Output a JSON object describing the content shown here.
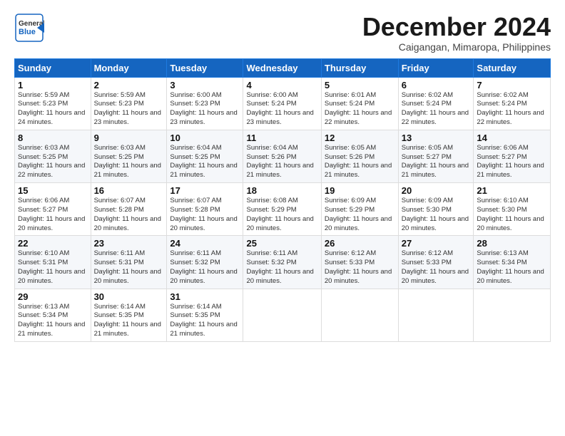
{
  "header": {
    "logo_general": "General",
    "logo_blue": "Blue",
    "month_title": "December 2024",
    "location": "Caigangan, Mimaropa, Philippines"
  },
  "days_of_week": [
    "Sunday",
    "Monday",
    "Tuesday",
    "Wednesday",
    "Thursday",
    "Friday",
    "Saturday"
  ],
  "weeks": [
    [
      {
        "day": "1",
        "sunrise": "Sunrise: 5:59 AM",
        "sunset": "Sunset: 5:23 PM",
        "daylight": "Daylight: 11 hours and 24 minutes."
      },
      {
        "day": "2",
        "sunrise": "Sunrise: 5:59 AM",
        "sunset": "Sunset: 5:23 PM",
        "daylight": "Daylight: 11 hours and 23 minutes."
      },
      {
        "day": "3",
        "sunrise": "Sunrise: 6:00 AM",
        "sunset": "Sunset: 5:23 PM",
        "daylight": "Daylight: 11 hours and 23 minutes."
      },
      {
        "day": "4",
        "sunrise": "Sunrise: 6:00 AM",
        "sunset": "Sunset: 5:24 PM",
        "daylight": "Daylight: 11 hours and 23 minutes."
      },
      {
        "day": "5",
        "sunrise": "Sunrise: 6:01 AM",
        "sunset": "Sunset: 5:24 PM",
        "daylight": "Daylight: 11 hours and 22 minutes."
      },
      {
        "day": "6",
        "sunrise": "Sunrise: 6:02 AM",
        "sunset": "Sunset: 5:24 PM",
        "daylight": "Daylight: 11 hours and 22 minutes."
      },
      {
        "day": "7",
        "sunrise": "Sunrise: 6:02 AM",
        "sunset": "Sunset: 5:24 PM",
        "daylight": "Daylight: 11 hours and 22 minutes."
      }
    ],
    [
      {
        "day": "8",
        "sunrise": "Sunrise: 6:03 AM",
        "sunset": "Sunset: 5:25 PM",
        "daylight": "Daylight: 11 hours and 22 minutes."
      },
      {
        "day": "9",
        "sunrise": "Sunrise: 6:03 AM",
        "sunset": "Sunset: 5:25 PM",
        "daylight": "Daylight: 11 hours and 21 minutes."
      },
      {
        "day": "10",
        "sunrise": "Sunrise: 6:04 AM",
        "sunset": "Sunset: 5:25 PM",
        "daylight": "Daylight: 11 hours and 21 minutes."
      },
      {
        "day": "11",
        "sunrise": "Sunrise: 6:04 AM",
        "sunset": "Sunset: 5:26 PM",
        "daylight": "Daylight: 11 hours and 21 minutes."
      },
      {
        "day": "12",
        "sunrise": "Sunrise: 6:05 AM",
        "sunset": "Sunset: 5:26 PM",
        "daylight": "Daylight: 11 hours and 21 minutes."
      },
      {
        "day": "13",
        "sunrise": "Sunrise: 6:05 AM",
        "sunset": "Sunset: 5:27 PM",
        "daylight": "Daylight: 11 hours and 21 minutes."
      },
      {
        "day": "14",
        "sunrise": "Sunrise: 6:06 AM",
        "sunset": "Sunset: 5:27 PM",
        "daylight": "Daylight: 11 hours and 21 minutes."
      }
    ],
    [
      {
        "day": "15",
        "sunrise": "Sunrise: 6:06 AM",
        "sunset": "Sunset: 5:27 PM",
        "daylight": "Daylight: 11 hours and 20 minutes."
      },
      {
        "day": "16",
        "sunrise": "Sunrise: 6:07 AM",
        "sunset": "Sunset: 5:28 PM",
        "daylight": "Daylight: 11 hours and 20 minutes."
      },
      {
        "day": "17",
        "sunrise": "Sunrise: 6:07 AM",
        "sunset": "Sunset: 5:28 PM",
        "daylight": "Daylight: 11 hours and 20 minutes."
      },
      {
        "day": "18",
        "sunrise": "Sunrise: 6:08 AM",
        "sunset": "Sunset: 5:29 PM",
        "daylight": "Daylight: 11 hours and 20 minutes."
      },
      {
        "day": "19",
        "sunrise": "Sunrise: 6:09 AM",
        "sunset": "Sunset: 5:29 PM",
        "daylight": "Daylight: 11 hours and 20 minutes."
      },
      {
        "day": "20",
        "sunrise": "Sunrise: 6:09 AM",
        "sunset": "Sunset: 5:30 PM",
        "daylight": "Daylight: 11 hours and 20 minutes."
      },
      {
        "day": "21",
        "sunrise": "Sunrise: 6:10 AM",
        "sunset": "Sunset: 5:30 PM",
        "daylight": "Daylight: 11 hours and 20 minutes."
      }
    ],
    [
      {
        "day": "22",
        "sunrise": "Sunrise: 6:10 AM",
        "sunset": "Sunset: 5:31 PM",
        "daylight": "Daylight: 11 hours and 20 minutes."
      },
      {
        "day": "23",
        "sunrise": "Sunrise: 6:11 AM",
        "sunset": "Sunset: 5:31 PM",
        "daylight": "Daylight: 11 hours and 20 minutes."
      },
      {
        "day": "24",
        "sunrise": "Sunrise: 6:11 AM",
        "sunset": "Sunset: 5:32 PM",
        "daylight": "Daylight: 11 hours and 20 minutes."
      },
      {
        "day": "25",
        "sunrise": "Sunrise: 6:11 AM",
        "sunset": "Sunset: 5:32 PM",
        "daylight": "Daylight: 11 hours and 20 minutes."
      },
      {
        "day": "26",
        "sunrise": "Sunrise: 6:12 AM",
        "sunset": "Sunset: 5:33 PM",
        "daylight": "Daylight: 11 hours and 20 minutes."
      },
      {
        "day": "27",
        "sunrise": "Sunrise: 6:12 AM",
        "sunset": "Sunset: 5:33 PM",
        "daylight": "Daylight: 11 hours and 20 minutes."
      },
      {
        "day": "28",
        "sunrise": "Sunrise: 6:13 AM",
        "sunset": "Sunset: 5:34 PM",
        "daylight": "Daylight: 11 hours and 20 minutes."
      }
    ],
    [
      {
        "day": "29",
        "sunrise": "Sunrise: 6:13 AM",
        "sunset": "Sunset: 5:34 PM",
        "daylight": "Daylight: 11 hours and 21 minutes."
      },
      {
        "day": "30",
        "sunrise": "Sunrise: 6:14 AM",
        "sunset": "Sunset: 5:35 PM",
        "daylight": "Daylight: 11 hours and 21 minutes."
      },
      {
        "day": "31",
        "sunrise": "Sunrise: 6:14 AM",
        "sunset": "Sunset: 5:35 PM",
        "daylight": "Daylight: 11 hours and 21 minutes."
      },
      null,
      null,
      null,
      null
    ]
  ]
}
